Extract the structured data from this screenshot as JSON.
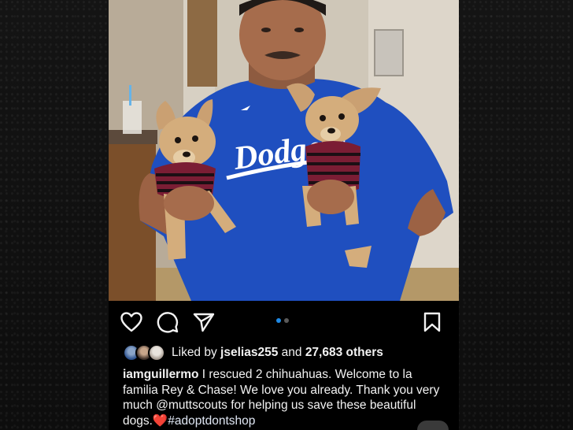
{
  "post": {
    "liked_by_prefix": "Liked by",
    "liked_by_user": "jselias255",
    "liked_by_and": "and",
    "liked_by_count": "27,683 others",
    "caption_user": "iamguillermo",
    "caption_text": "I rescued 2 chihuahuas. Welcome to la familia Rey & Chase! We love you already. Thank you very much @muttscouts for helping us save these beautiful dogs.",
    "caption_emoji": "❤️",
    "caption_hashtag": "#adoptdontshop",
    "shirt_text": "Dodgers",
    "carousel": {
      "total": 2,
      "active_index": 0
    }
  },
  "icons": {
    "like": "heart-outline-icon",
    "comment": "comment-icon",
    "share": "paper-plane-icon",
    "save": "bookmark-icon"
  },
  "colors": {
    "accent_blue": "#1f8ae6",
    "text": "#f2f2f2",
    "jersey_blue": "#1f4fbf",
    "background": "#000000"
  }
}
